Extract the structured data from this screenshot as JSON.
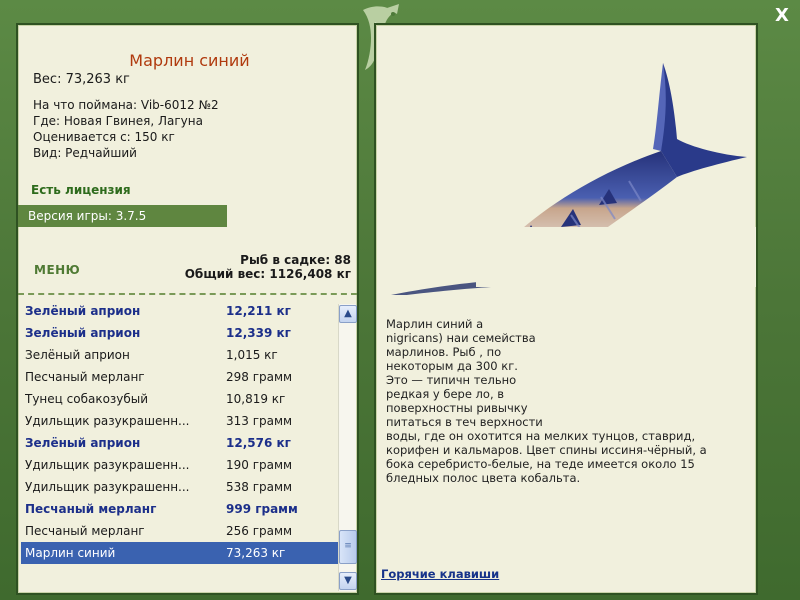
{
  "window": {
    "close_label": "X"
  },
  "fish": {
    "title": "Марлин синий",
    "weight": "Вес: 73,263 кг",
    "info": [
      "На что поймана: Vib-6012 №2",
      "Где: Новая Гвинея, Лагуна",
      "Оценивается с: 150 кг",
      "Вид: Редчайший"
    ]
  },
  "license": "Есть лицензия",
  "version": "Версия игры: 3.7.5",
  "menu_label": "МЕНЮ",
  "stats": {
    "count": "Рыб в садке: 88",
    "total": "Общий вес: 1126,408 кг"
  },
  "catch_list": [
    {
      "name": "Зелёный априон",
      "weight": "12,211 кг",
      "style": "bold"
    },
    {
      "name": "Зелёный априон",
      "weight": "12,339 кг",
      "style": "bold"
    },
    {
      "name": "Зелёный априон",
      "weight": "1,015 кг",
      "style": "normal"
    },
    {
      "name": "Песчаный мерланг",
      "weight": "298 грамм",
      "style": "normal"
    },
    {
      "name": "Тунец собакозубый",
      "weight": "10,819 кг",
      "style": "normal"
    },
    {
      "name": "Удильщик разукрашенн...",
      "weight": "313 грамм",
      "style": "normal"
    },
    {
      "name": "Зелёный априон",
      "weight": "12,576 кг",
      "style": "bold"
    },
    {
      "name": "Удильщик разукрашенн...",
      "weight": "190 грамм",
      "style": "normal"
    },
    {
      "name": "Удильщик разукрашенн...",
      "weight": "538 грамм",
      "style": "normal"
    },
    {
      "name": "Песчаный мерланг",
      "weight": "999 грамм",
      "style": "bold"
    },
    {
      "name": "Песчаный мерланг",
      "weight": "256 грамм",
      "style": "normal"
    },
    {
      "name": "Марлин синий",
      "weight": "73,263 кг",
      "style": "selected"
    }
  ],
  "description": [
    "Марлин синий                                          а",
    "nigricans) наи                                        семейства",
    "марлинов. Рыб                                         , по",
    "некоторым да                                          300 кг.",
    "Это — типичн                                          тельно",
    "редкая у бере                                         ло, в",
    "поверхностны                                          ривычку",
    "питаться в теч                                        верхности",
    "воды, где он охотится на мелких тунцов, ставрид,",
    "корифен и кальмаров. Цвет спины иссиня-чёрный, а",
    "бока серебристо-белые, на теде имеется около 15",
    "бледных полос цвета кобальта."
  ],
  "hotkeys_label": "Горячие клавиши",
  "colors": {
    "frame": "#4e7a3a",
    "panel": "#f1f0dd",
    "title": "#b03a0e",
    "highlight_row": "#3a62b0",
    "bold_entry": "#1c2f8a"
  }
}
